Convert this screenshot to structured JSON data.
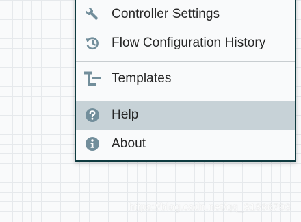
{
  "menu": {
    "items": [
      {
        "icon": "wrench-icon",
        "label": "Controller Settings"
      },
      {
        "icon": "history-icon",
        "label": "Flow Configuration History"
      },
      {
        "icon": "templates-icon",
        "label": "Templates"
      },
      {
        "icon": "help-icon",
        "label": "Help",
        "active": true
      },
      {
        "icon": "info-icon",
        "label": "About"
      }
    ]
  },
  "colors": {
    "icon": "#728e9b",
    "active_background": "#c7d2d7",
    "border": "#0e3a3f"
  },
  "watermark": "https://blog.csdn.net/qq_31866793"
}
